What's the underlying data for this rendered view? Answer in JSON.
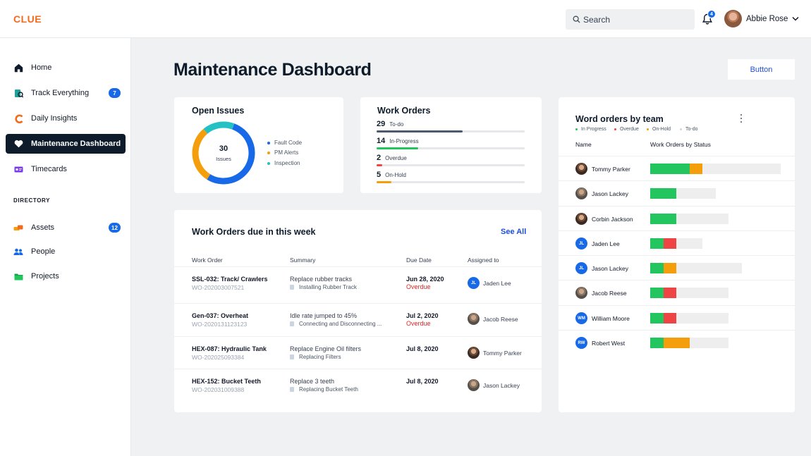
{
  "app": {
    "logo": "CLUE"
  },
  "header": {
    "search_placeholder": "Search",
    "notification_count": "4",
    "user_name": "Abbie Rose"
  },
  "sidebar": {
    "items": [
      {
        "label": "Home",
        "icon": "home-icon"
      },
      {
        "label": "Track Everything",
        "icon": "track-icon",
        "badge": "7"
      },
      {
        "label": "Daily Insights",
        "icon": "insights-icon"
      },
      {
        "label": "Maintenance Dashboard",
        "icon": "heart-icon",
        "active": true
      },
      {
        "label": "Timecards",
        "icon": "timecard-icon"
      }
    ],
    "directory_label": "DIRECTORY",
    "directory": [
      {
        "label": "Assets",
        "icon": "assets-icon",
        "badge": "12"
      },
      {
        "label": "People",
        "icon": "people-icon"
      },
      {
        "label": "Projects",
        "icon": "folder-icon"
      }
    ]
  },
  "main": {
    "title": "Maintenance Dashboard",
    "button_label": "Button",
    "open_issues": {
      "title": "Open Issues",
      "total": "30",
      "total_label": "Issues",
      "legend": [
        {
          "label": "Fault Code",
          "color": "#1769e8",
          "value": 16
        },
        {
          "label": "PM Alerts",
          "color": "#f59e0b",
          "value": 9
        },
        {
          "label": "Inspection",
          "color": "#22c1c3",
          "value": 5
        }
      ]
    },
    "work_orders": {
      "title": "Work Orders",
      "rows": [
        {
          "count": "29",
          "label": "To-do",
          "color": "#4b5a70",
          "fraction": 0.58
        },
        {
          "count": "14",
          "label": "In-Progress",
          "color": "#22c55e",
          "fraction": 0.28
        },
        {
          "count": "2",
          "label": "Overdue",
          "color": "#ef4444",
          "fraction": 0.04
        },
        {
          "count": "5",
          "label": "On-Hold",
          "color": "#f59e0b",
          "fraction": 0.1
        }
      ]
    },
    "due_week": {
      "title": "Work Orders due in this week",
      "see_all": "See All",
      "columns": [
        "Work Order",
        "Summary",
        "Due Date",
        "Assigned to"
      ],
      "rows": [
        {
          "order": "SSL-032: Track/ Crawlers",
          "order_id": "WO-202003007521",
          "summary": "Replace rubber tracks",
          "task": "Installing Rubber Track",
          "due": "Jun 28, 2020",
          "status": "Overdue",
          "assignee": "Jaden Lee",
          "initials": "JL"
        },
        {
          "order": "Gen-037: Overheat",
          "order_id": "WO-2020131123123",
          "summary": "Idle rate jumped to 45%",
          "task": "Connecting and Disconnecting ...",
          "due": "Jul 2, 2020",
          "status": "Overdue",
          "assignee": "Jacob Reese",
          "initials": ""
        },
        {
          "order": "HEX-087: Hydraulic Tank",
          "order_id": "WO-202025093384",
          "summary": "Replace Engine Oil filters",
          "task": "Replacing Filters",
          "due": "Jul 8, 2020",
          "status": "",
          "assignee": "Tommy Parker",
          "initials": ""
        },
        {
          "order": "HEX-152: Bucket Teeth",
          "order_id": "WO-202031009388",
          "summary": "Replace 3 teeth",
          "task": "Replacing Bucket Teeth",
          "due": "Jul 8, 2020",
          "status": "",
          "assignee": "Jason Lackey",
          "initials": ""
        }
      ]
    },
    "team": {
      "title": "Word orders by team",
      "legend": [
        {
          "label": "In Progress",
          "color": "#22c55e"
        },
        {
          "label": "Overdue",
          "color": "#ef4444"
        },
        {
          "label": "On-Hold",
          "color": "#f59e0b"
        },
        {
          "label": "To-do",
          "color": "#d1d5db"
        }
      ],
      "col_name": "Name",
      "col_status": "Work Orders by Status",
      "members": [
        {
          "name": "Tommy Parker",
          "initials": "",
          "in_progress": 15,
          "overdue": 0,
          "on_hold": 5,
          "todo": 30
        },
        {
          "name": "Jason Lackey",
          "initials": "",
          "in_progress": 10,
          "overdue": 0,
          "on_hold": 0,
          "todo": 15
        },
        {
          "name": "Corbin Jackson",
          "initials": "",
          "in_progress": 10,
          "overdue": 0,
          "on_hold": 0,
          "todo": 20
        },
        {
          "name": "Jaden Lee",
          "initials": "JL",
          "in_progress": 5,
          "overdue": 5,
          "on_hold": 0,
          "todo": 10
        },
        {
          "name": "Jason Lackey",
          "initials": "JL",
          "in_progress": 5,
          "overdue": 0,
          "on_hold": 5,
          "todo": 25
        },
        {
          "name": "Jacob Reese",
          "initials": "",
          "in_progress": 5,
          "overdue": 5,
          "on_hold": 0,
          "todo": 20
        },
        {
          "name": "William Moore",
          "initials": "WM",
          "in_progress": 5,
          "overdue": 5,
          "on_hold": 0,
          "todo": 20
        },
        {
          "name": "Robert West",
          "initials": "RW",
          "in_progress": 5,
          "overdue": 0,
          "on_hold": 10,
          "todo": 15
        }
      ]
    }
  }
}
